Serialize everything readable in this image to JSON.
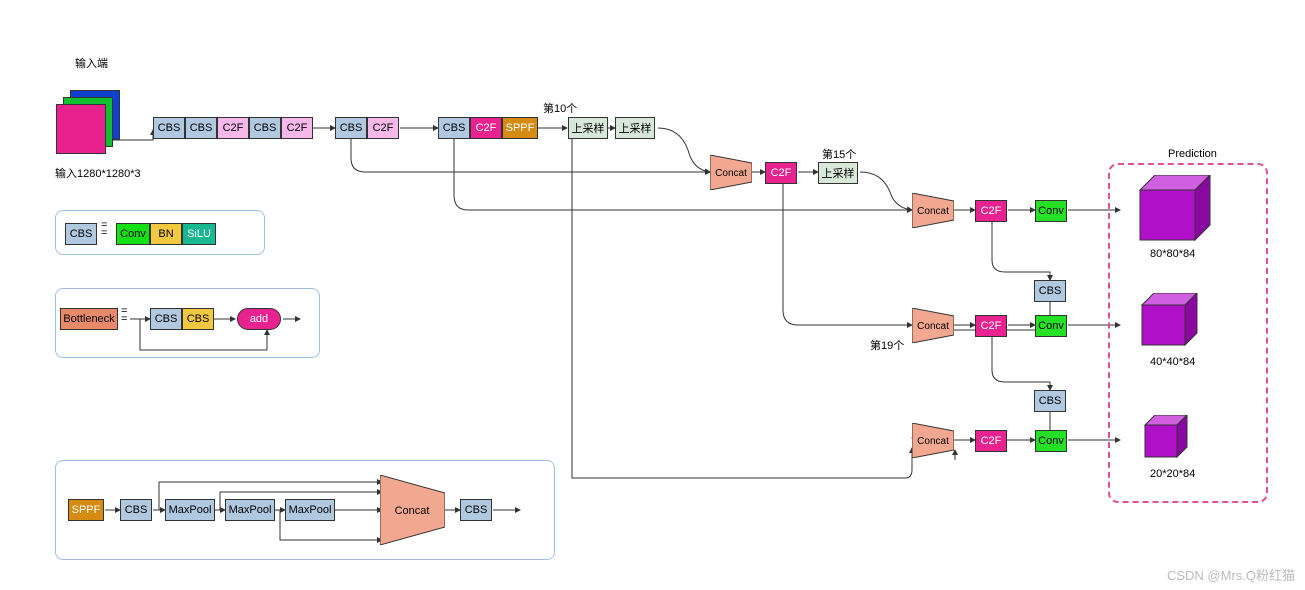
{
  "title_input": "输入端",
  "input_label": "输入1280*1280*3",
  "blocks": {
    "cbs": "CBS",
    "c2f": "C2F",
    "conv": "Conv",
    "bn": "BN",
    "silu": "SiLU",
    "bottleneck": "Bottleneck",
    "add": "add",
    "sppf": "SPPF",
    "maxpool": "MaxPool",
    "concat": "Concat",
    "upsample": "上采样"
  },
  "notes": {
    "n10": "第10个",
    "n15": "第15个",
    "n19": "第19个"
  },
  "prediction": {
    "title": "Prediction",
    "out1": "80*80*84",
    "out2": "40*40*84",
    "out3": "20*20*84"
  },
  "equals": "=",
  "watermark": "CSDN @Mrs.Q粉红猫"
}
